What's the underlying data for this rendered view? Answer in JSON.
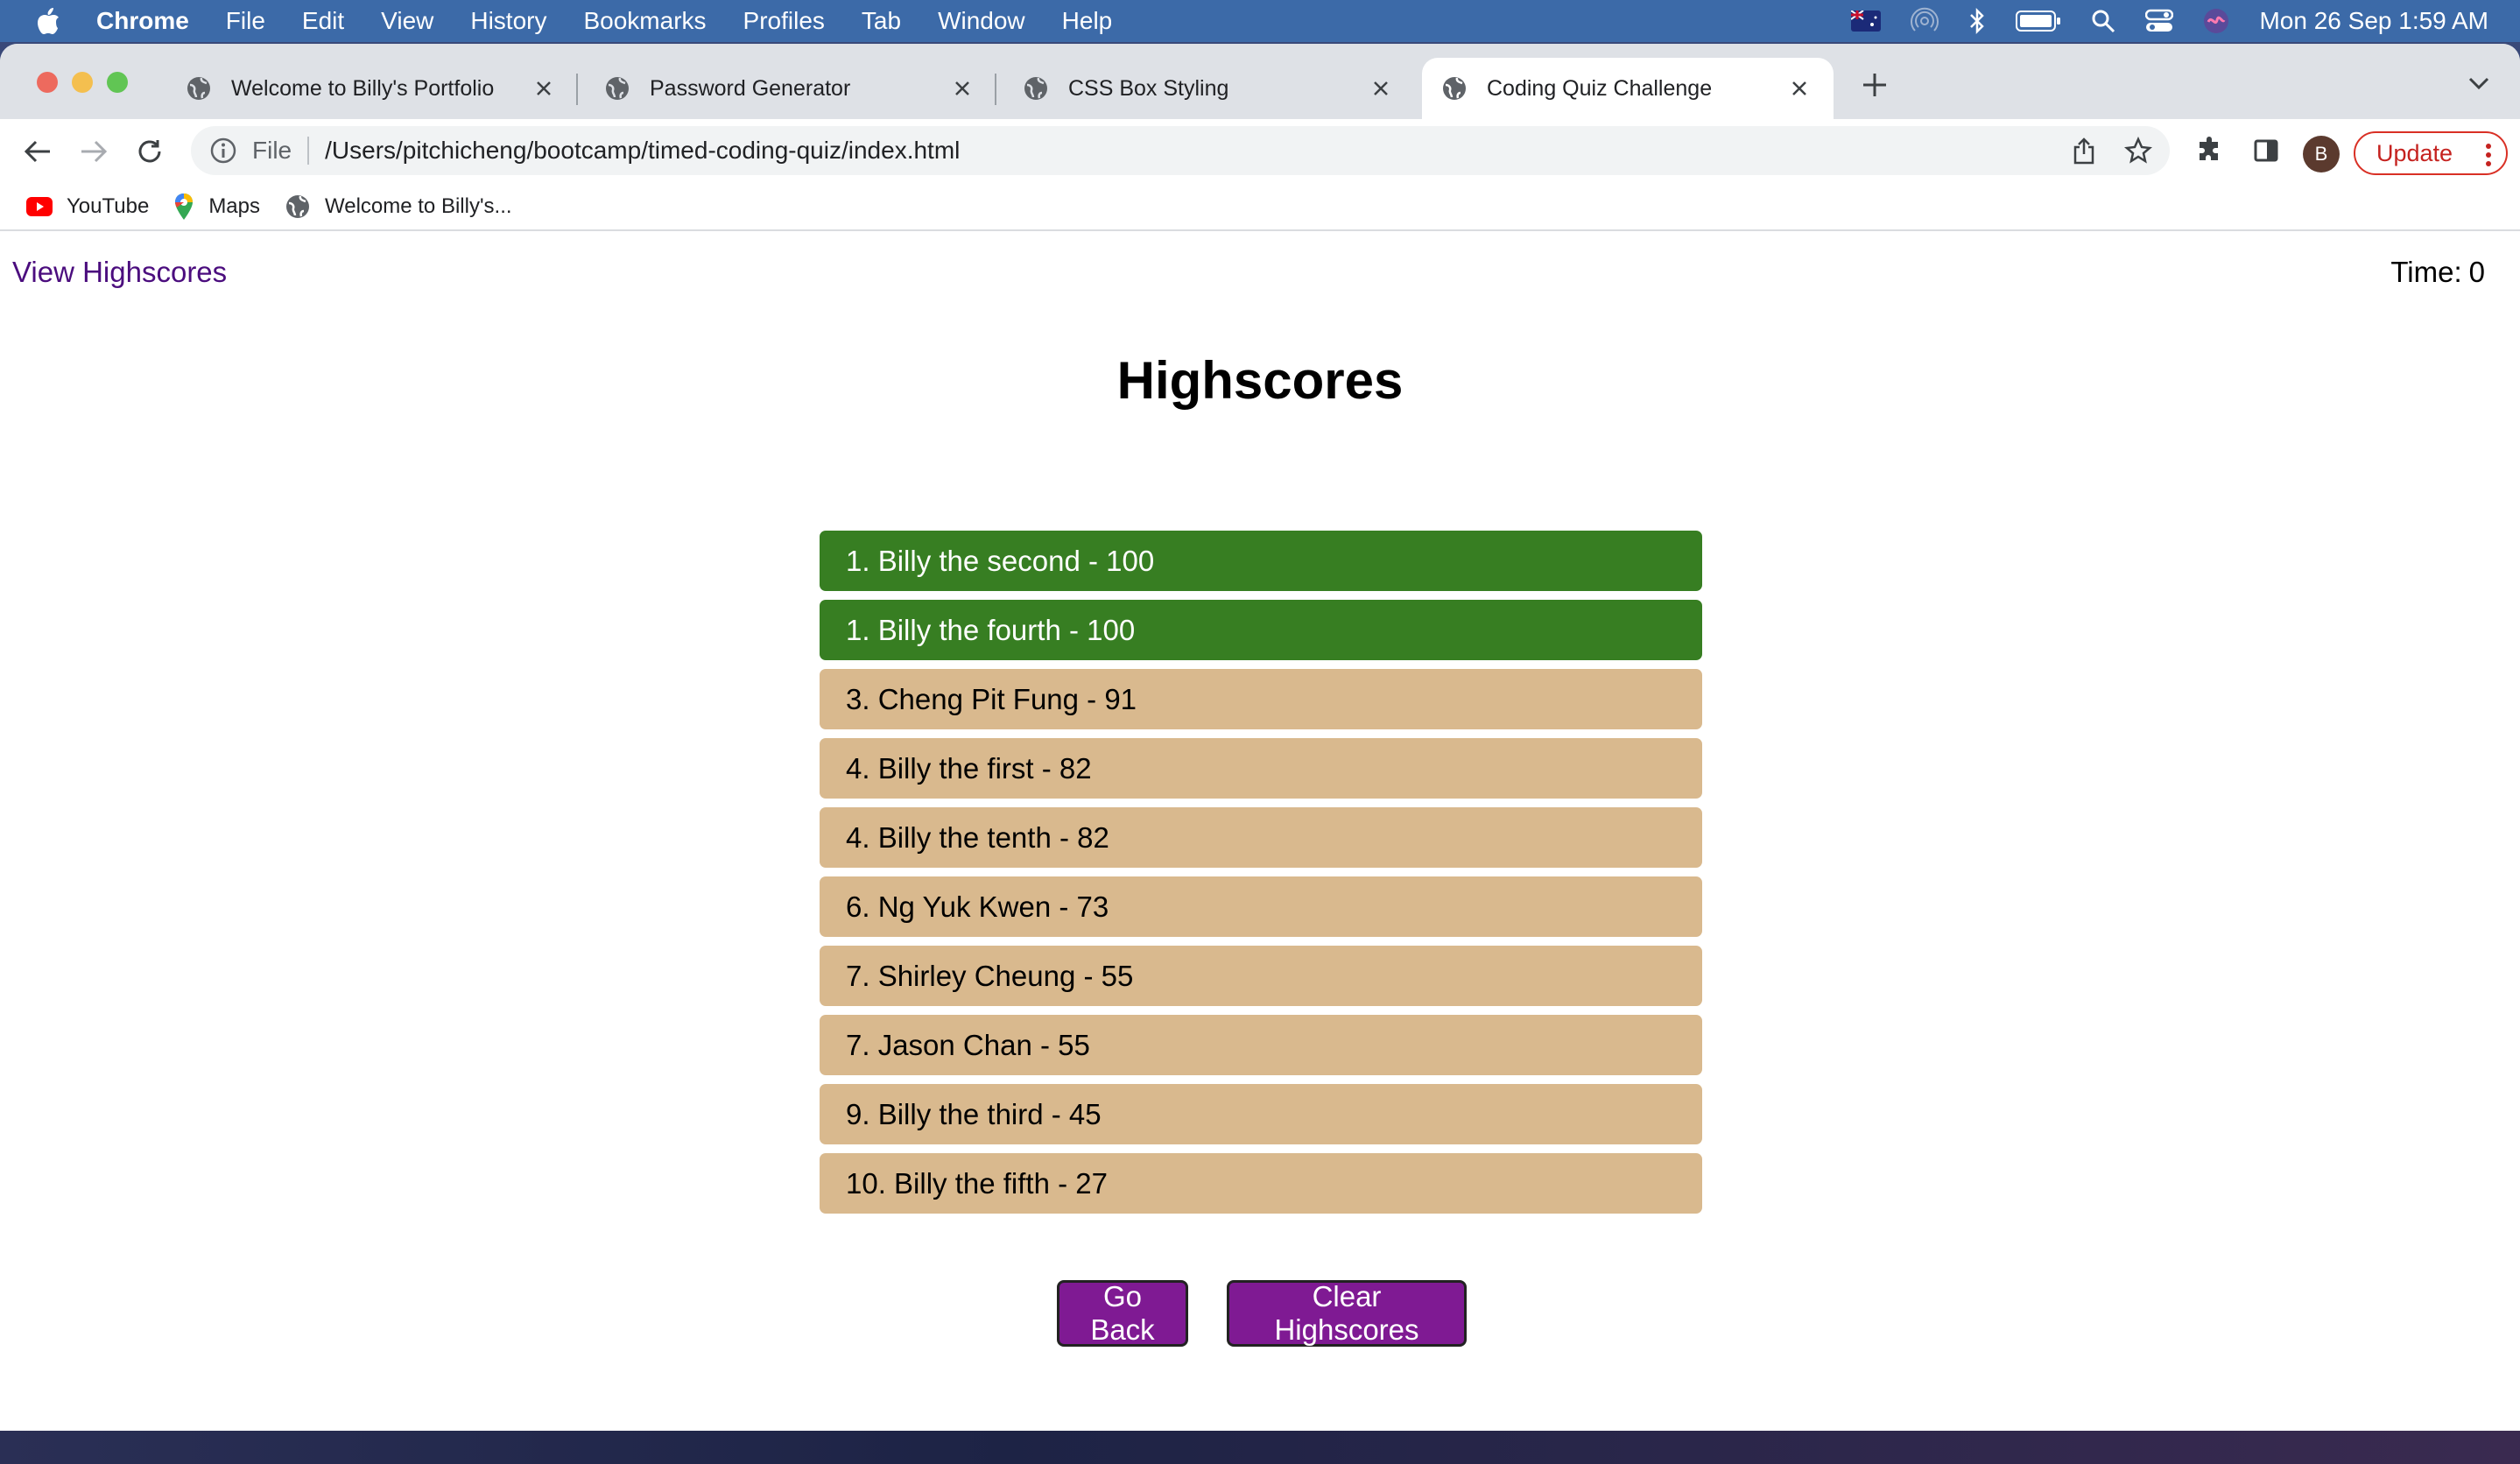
{
  "menubar": {
    "app": "Chrome",
    "items": [
      "File",
      "Edit",
      "View",
      "History",
      "Bookmarks",
      "Profiles",
      "Tab",
      "Window",
      "Help"
    ],
    "clock": "Mon 26 Sep  1:59 AM"
  },
  "tabs": [
    {
      "title": "Welcome to Billy's Portfolio",
      "active": false
    },
    {
      "title": "Password Generator",
      "active": false
    },
    {
      "title": "CSS Box Styling",
      "active": false
    },
    {
      "title": "Coding Quiz Challenge",
      "active": true
    }
  ],
  "omnibox": {
    "scheme": "File",
    "url": "/Users/pitchicheng/bootcamp/timed-coding-quiz/index.html"
  },
  "profile": {
    "initial": "B"
  },
  "update_label": "Update",
  "bookmarks": [
    {
      "label": "YouTube",
      "icon": "youtube-icon"
    },
    {
      "label": "Maps",
      "icon": "maps-icon"
    },
    {
      "label": "Welcome to Billy's...",
      "icon": "globe-icon"
    }
  ],
  "page": {
    "view_highscores": "View Highscores",
    "timer_label": "Time:",
    "timer_value": "0",
    "title": "Highscores",
    "scores": [
      "1. Billy the second - 100",
      "1. Billy the fourth - 100",
      "3. Cheng Pit Fung - 91",
      "4. Billy the first - 82",
      "4. Billy the tenth - 82",
      "6. Ng Yuk Kwen - 73",
      "7. Shirley Cheung - 55",
      "7. Jason Chan - 55",
      "9. Billy the third - 45",
      "10. Billy the fifth - 27"
    ],
    "go_back": "Go Back",
    "clear_highscores": "Clear Highscores"
  },
  "colors": {
    "top_score": "#377e22",
    "other_score": "#d9b98e",
    "button": "#7f1a93",
    "link": "#4b0d7e"
  }
}
